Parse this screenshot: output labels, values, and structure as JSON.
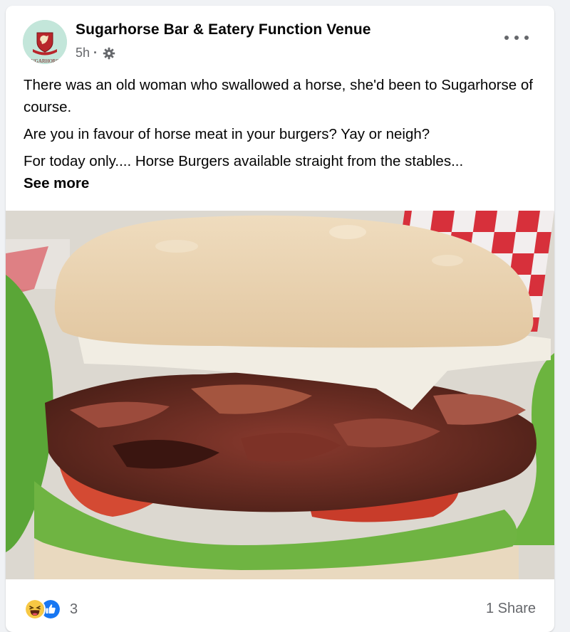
{
  "post": {
    "page_name": "Sugarhorse Bar & Eatery Function Venue",
    "time_ago": "5h",
    "separator": "·",
    "audience_icon": "gear-icon",
    "menu_icon": "more-options-icon",
    "avatar_text": "UGARHORS",
    "paragraphs": [
      "There was an old woman who swallowed a horse, she'd been to Sugarhorse of course.",
      "Are you in favour of horse meat in your burgers? Yay or neigh?",
      "For today only.... Horse Burgers available straight from the stables..."
    ],
    "see_more": "See more",
    "image_icon": "burger-photo"
  },
  "footer": {
    "reactions": [
      "haha-reaction-icon",
      "like-reaction-icon"
    ],
    "reaction_count": "3",
    "shares": "1 Share"
  },
  "colors": {
    "secondary_text": "#65676b",
    "like_blue": "#1877f2",
    "haha_yellow": "#f7c844",
    "avatar_bg": "#bfe3d6"
  }
}
